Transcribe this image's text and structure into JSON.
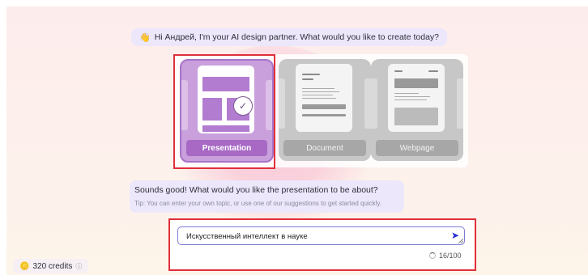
{
  "greeting": {
    "text": "Hi Андрей, I'm your AI design partner. What would you like to create today?"
  },
  "cards": [
    {
      "label": "Presentation",
      "selected": true
    },
    {
      "label": "Document",
      "selected": false
    },
    {
      "label": "Webpage",
      "selected": false
    }
  ],
  "prompt": {
    "question": "Sounds good! What would you like the presentation to be about?",
    "tip": "Tip: You can enter your own topic, or use one of our suggestions to get started quickly."
  },
  "input": {
    "value": "Искусственный интеллект в науке",
    "counter": "16/100"
  },
  "credits": {
    "label": "320 credits"
  },
  "colors": {
    "accent": "#a769c4",
    "highlight": "#e0303a",
    "send": "#2a2fd6"
  }
}
